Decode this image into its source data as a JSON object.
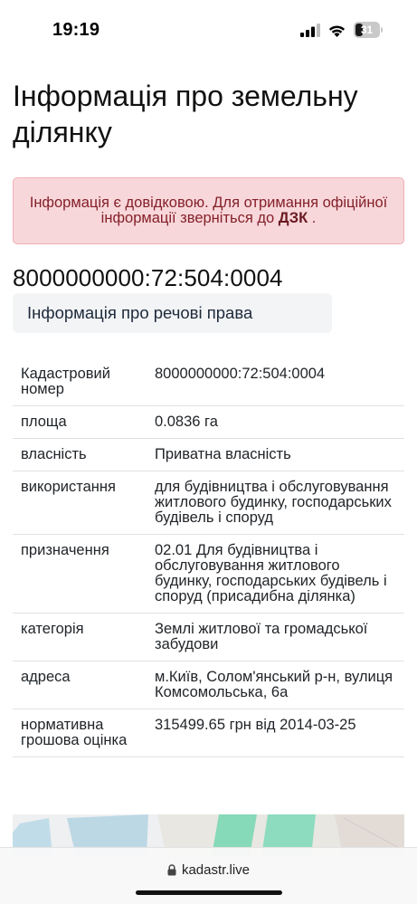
{
  "status_bar": {
    "time": "19:19",
    "battery_level": "31",
    "battery_fraction": 0.31
  },
  "page": {
    "title": "Інформація про земельну ділянку",
    "alert": {
      "text_before": "Інформація є довідковою. Для отримання офіційної інформації зверніться до ",
      "link": "ДЗК",
      "text_after": " ."
    },
    "cadastral_number": "8000000000:72:504:0004",
    "tab_label": "Інформація про речові права"
  },
  "table": {
    "rows": [
      {
        "key": "Кадастровий номер",
        "value": "8000000000:72:504:0004"
      },
      {
        "key": "площа",
        "value": "0.0836 га"
      },
      {
        "key": "власність",
        "value": "Приватна власність"
      },
      {
        "key": "використання",
        "value": "для будівництва і обслуговування житлового будинку, господарських будівель і споруд"
      },
      {
        "key": "призначення",
        "value": "02.01 Для будівництва і обслуговування житлового будинку, господарських будівель і споруд (присадибна ділянка)"
      },
      {
        "key": "категорія",
        "value": "Землі житлової та громадської забудови"
      },
      {
        "key": "адреса",
        "value": "м.Київ, Солом'янський р-н, вулиця Комсомольська, 6а"
      },
      {
        "key": "нормативна грошова оцінка",
        "value": "315499.65 грн від 2014-03-25"
      }
    ]
  },
  "browser": {
    "url": "kadastr.live"
  },
  "colors": {
    "alert_bg": "#f8d7da",
    "alert_text": "#842029",
    "map_green": "#7fd6b4",
    "map_blue": "#9ec6dc"
  }
}
